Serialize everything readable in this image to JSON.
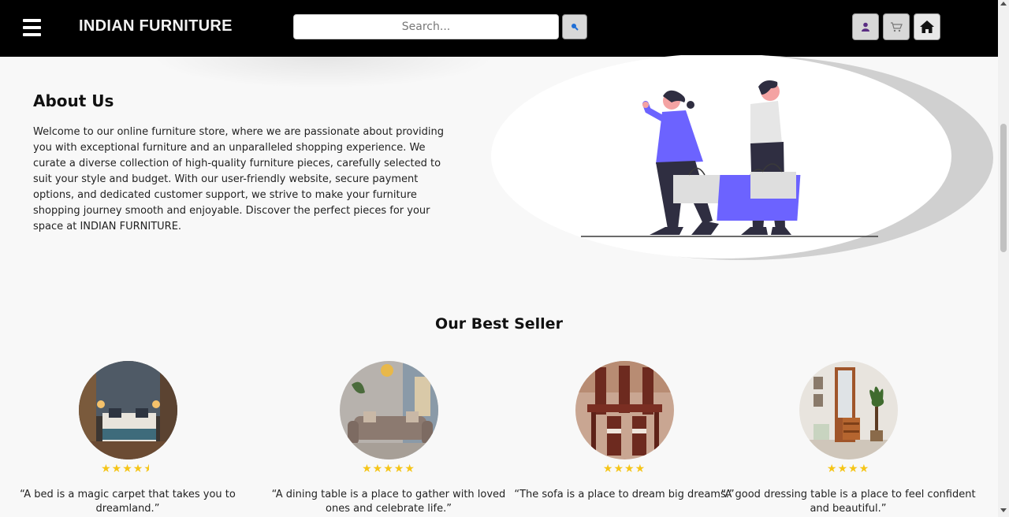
{
  "header": {
    "brand": "INDIAN FURNITURE",
    "search_placeholder": "Search...",
    "icons": [
      "menu-icon",
      "search-icon",
      "user-icon",
      "cart-icon",
      "home-icon"
    ]
  },
  "about": {
    "title": "About Us",
    "text": "Welcome to our online furniture store, where we are passionate about providing you with exceptional furniture and an unparalleled shopping experience. We curate a diverse collection of high-quality furniture pieces, carefully selected to suit your style and budget. With our user-friendly website, secure payment options, and dedicated customer support, we strive to make your furniture shopping journey smooth and enjoyable. Discover the perfect pieces for your space at INDIAN FURNITURE."
  },
  "best_seller": {
    "title": "Our Best Seller",
    "products": [
      {
        "name": "bed",
        "rating": 4.5,
        "quote": "“A bed is a magic carpet that takes you to dreamland.”"
      },
      {
        "name": "sofa",
        "rating": 5,
        "quote": "“A dining table is a place to gather with loved ones and celebrate life.”"
      },
      {
        "name": "dining-table",
        "rating": 4,
        "quote": "“The sofa is a place to dream big dreams.”"
      },
      {
        "name": "dressing-table",
        "rating": 4,
        "quote": "“A good dressing table is a place to feel confident and beautiful.”"
      }
    ]
  },
  "colors": {
    "header_bg": "#000000",
    "star": "#f5c518",
    "accent_bag": "#6c63ff"
  }
}
